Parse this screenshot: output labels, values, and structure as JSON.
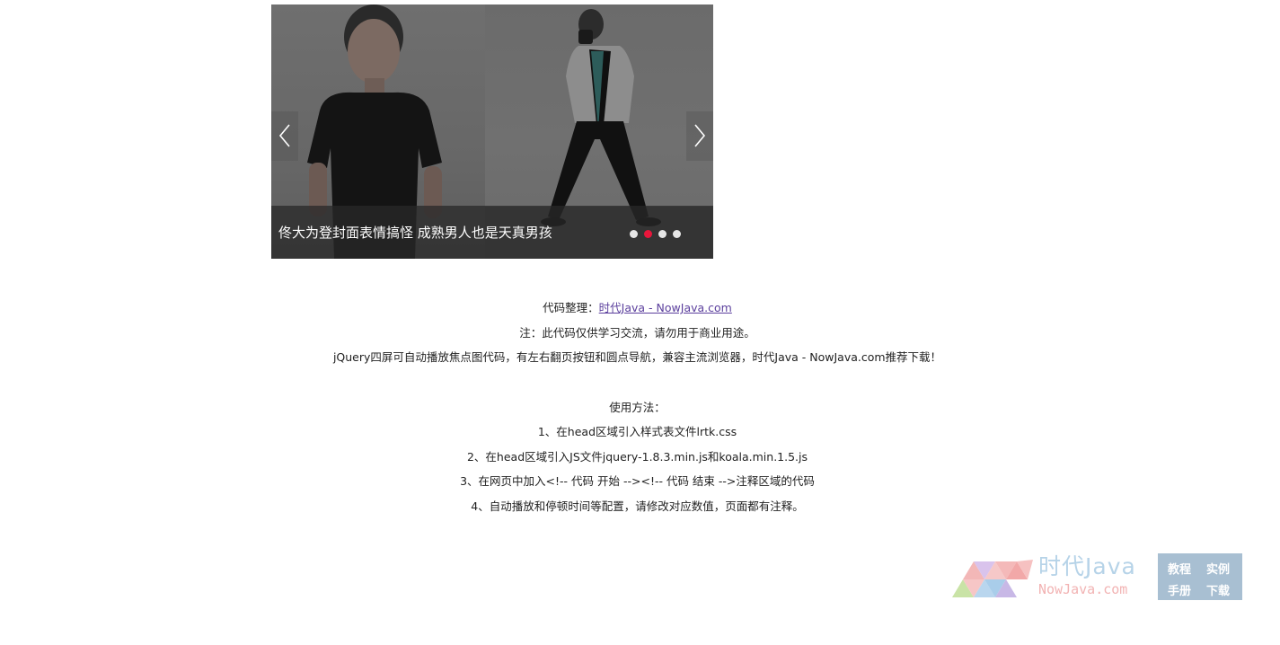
{
  "slider": {
    "caption": "佟大为登封面表情搞怪 成熟男人也是天真男孩",
    "active_index": 2,
    "slide_count": 4
  },
  "info": {
    "credit_label": "代码整理：",
    "credit_link": "时代Java - NowJava.com",
    "note": "注：此代码仅供学习交流，请勿用于商业用途。",
    "description": "jQuery四屏可自动播放焦点图代码，有左右翻页按钮和圆点导航，兼容主流浏览器，时代Java - NowJava.com推荐下载！",
    "usage_title": "使用方法：",
    "steps": [
      "1、在head区域引入样式表文件lrtk.css",
      "2、在head区域引入JS文件jquery-1.8.3.min.js和koala.min.1.5.js",
      "3、在网页中加入<!-- 代码 开始 --><!-- 代码 结束 -->注释区域的代码",
      "4、自动播放和停顿时间等配置，请修改对应数值，页面都有注释。"
    ]
  },
  "logo": {
    "title": "时代Java",
    "subtitle": "NowJava.com",
    "links": [
      "教程",
      "实例",
      "手册",
      "下载"
    ]
  },
  "colors": {
    "active_dot": "#e8163b",
    "link": "#5b3f9d",
    "logo_blue": "#b6d3e8",
    "logo_pink": "#f2b3b3",
    "logo_box": "#a8bfd2"
  }
}
